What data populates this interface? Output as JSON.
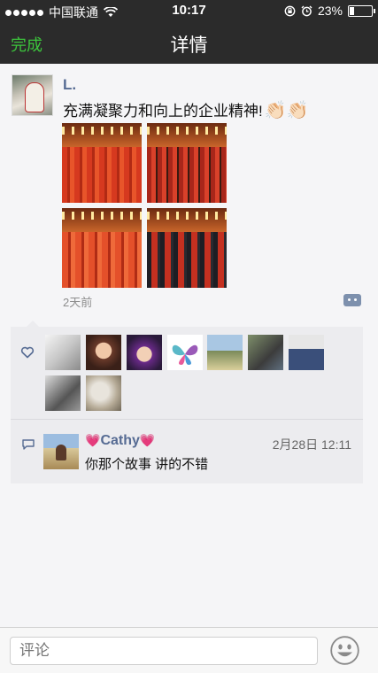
{
  "status_bar": {
    "carrier": "中国联通",
    "time": "10:17",
    "battery": "23%",
    "battery_level": 0.23
  },
  "nav": {
    "done_label": "完成",
    "title": "详情"
  },
  "post": {
    "author": "L.",
    "text": "充满凝聚力和向上的企业精神!",
    "emoji": "👏🏻👏🏻",
    "time_ago": "2天前",
    "photo_count": 4
  },
  "likes": {
    "count": 9
  },
  "comments": [
    {
      "name": "Cathy",
      "name_decoration": "💗",
      "time": "2月28日 12:11",
      "text": "你那个故事  讲的不错"
    }
  ],
  "input": {
    "placeholder": "评论"
  },
  "colors": {
    "accent_green": "#3cc43c",
    "link_blue": "#566b93",
    "nav_bg": "#2b2b2b"
  }
}
